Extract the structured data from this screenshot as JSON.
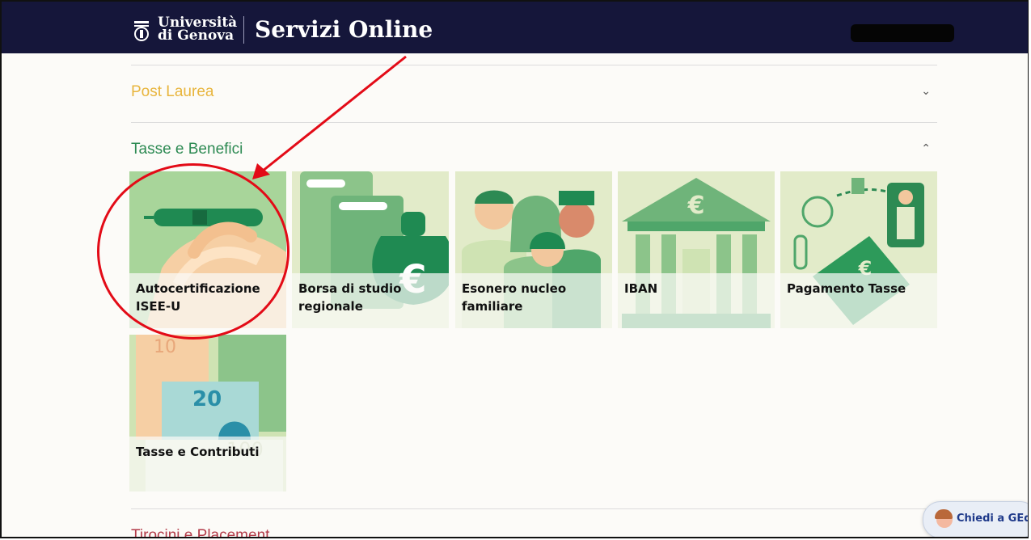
{
  "header": {
    "logo_line1": "Università",
    "logo_line2": "di Genova",
    "title": "Servizi Online"
  },
  "sections": {
    "post_laurea": {
      "label": "Post Laurea",
      "chevron": "⌄",
      "color": "#e8b53d"
    },
    "tasse": {
      "label": "Tasse e Benefici",
      "chevron": "⌃",
      "color": "#2d8a53"
    },
    "tirocini": {
      "label": "Tirocini e Placement",
      "color": "#b23a48"
    }
  },
  "tiles": [
    {
      "line1": "Autocertificazione",
      "line2": "ISEE-U",
      "icon": "pen-in-hand-icon"
    },
    {
      "line1": "Borsa di studio",
      "line2": "regionale",
      "icon": "money-bag-euro-icon"
    },
    {
      "line1": "Esonero nucleo",
      "line2": "familiare",
      "icon": "family-icon"
    },
    {
      "line1": "IBAN",
      "line2": "",
      "icon": "bank-building-icon"
    },
    {
      "line1": "Pagamento Tasse",
      "line2": "",
      "icon": "card-payment-icon"
    },
    {
      "line1": "Tasse e Contributi",
      "line2": "",
      "icon": "banknotes-icon"
    }
  ],
  "chat": {
    "label": "Chiedi a GEdi"
  },
  "colors": {
    "header_bg": "#15163a",
    "annotation_red": "#e30b17",
    "tile_green": "#2d9a5a"
  }
}
